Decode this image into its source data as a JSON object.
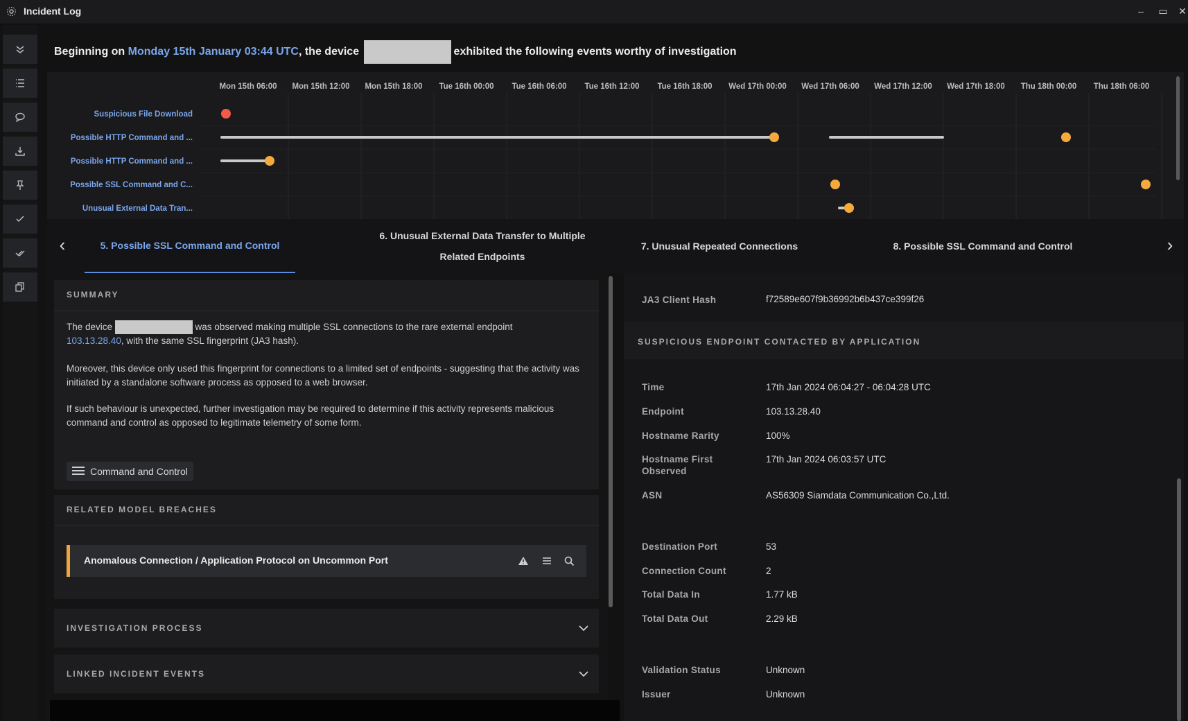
{
  "window": {
    "title": "Incident Log",
    "minimize": "–",
    "maximize": "▭",
    "close": "✕"
  },
  "sidebar": {
    "items": [
      {
        "name": "collapse-icon"
      },
      {
        "name": "list-icon"
      },
      {
        "name": "comment-icon"
      },
      {
        "name": "download-icon"
      },
      {
        "name": "pin-icon"
      },
      {
        "name": "check-icon"
      },
      {
        "name": "double-check-icon"
      },
      {
        "name": "copy-icon"
      }
    ]
  },
  "header": {
    "prefix": "Beginning on ",
    "date": "Monday 15th January 03:44 UTC",
    "mid": ", the device ",
    "suffix": "exhibited the following events worthy of investigation"
  },
  "timeline": {
    "x_labels": [
      "Mon 15th 06:00",
      "Mon 15th 12:00",
      "Mon 15th 18:00",
      "Tue 16th 00:00",
      "Tue 16th 06:00",
      "Tue 16th 12:00",
      "Tue 16th 18:00",
      "Wed 17th 00:00",
      "Wed 17th 06:00",
      "Wed 17th 12:00",
      "Wed 17th 18:00",
      "Thu 18th 00:00",
      "Thu 18th 06:00"
    ],
    "rows": [
      {
        "label": "Suspicious File Download"
      },
      {
        "label": "Possible HTTP Command and ..."
      },
      {
        "label": "Possible HTTP Command and ..."
      },
      {
        "label": "Possible SSL Command and C..."
      },
      {
        "label": "Unusual External Data Tran..."
      }
    ],
    "colors": {
      "red": "#f05a4b",
      "orange": "#f6aa3c",
      "bar": "#c8c8c8"
    }
  },
  "tabs": {
    "prev": "‹",
    "next": "›",
    "items": [
      {
        "label": "5. Possible SSL Command and Control",
        "active": true
      },
      {
        "label": "6. Unusual External Data Transfer to Multiple Related Endpoints"
      },
      {
        "label": "7. Unusual Repeated Connections"
      },
      {
        "label": "8. Possible SSL Command and Control"
      }
    ]
  },
  "summary": {
    "title": "SUMMARY",
    "p1_a": "The device ",
    "p1_b": " was observed making multiple SSL connections to the rare external endpoint",
    "p1_ip": "103.13.28.40",
    "p1_c": ", with the same SSL fingerprint (JA3 hash).",
    "p2": "Moreover, this device only used this fingerprint for connections to a limited set of endpoints - suggesting that the activity was initiated by a standalone software process as opposed to a web browser.",
    "p3": "If such behaviour is unexpected, further investigation may be required to determine if this activity represents malicious command and control as opposed to legitimate telemetry of some form.",
    "tag": "Command and Control"
  },
  "related": {
    "title": "RELATED MODEL BREACHES",
    "breach": "Anomalous Connection / Application Protocol on Uncommon Port"
  },
  "investigation": {
    "title": "INVESTIGATION PROCESS"
  },
  "linked": {
    "title": "LINKED INCIDENT EVENTS"
  },
  "details": {
    "ja3_label": "JA3 Client Hash",
    "ja3_value": "f72589e607f9b36992b6b437ce399f26",
    "section_title": "SUSPICIOUS ENDPOINT CONTACTED BY APPLICATION",
    "rows": [
      {
        "label": "Time",
        "value": "17th Jan 2024 06:04:27 - 06:04:28 UTC"
      },
      {
        "label": "Endpoint",
        "value": "103.13.28.40"
      },
      {
        "label": "Hostname Rarity",
        "value": "100%"
      },
      {
        "label": "Hostname First Observed",
        "value": "17th Jan 2024 06:03:57 UTC"
      },
      {
        "label": "ASN",
        "value": "AS56309 Siamdata Communication Co.,Ltd."
      },
      {
        "label": "Destination Port",
        "value": "53"
      },
      {
        "label": "Connection Count",
        "value": "2"
      },
      {
        "label": "Total Data In",
        "value": "1.77 kB"
      },
      {
        "label": "Total Data Out",
        "value": "2.29 kB"
      },
      {
        "label": "Validation Status",
        "value": "Unknown"
      },
      {
        "label": "Issuer",
        "value": "Unknown"
      }
    ]
  }
}
